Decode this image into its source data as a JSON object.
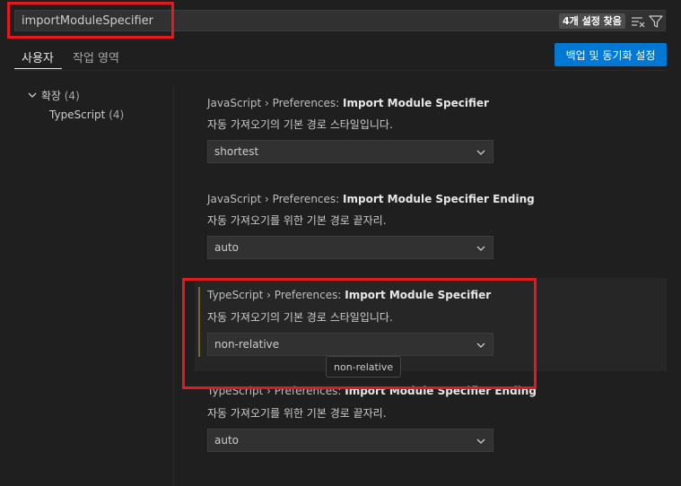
{
  "search": {
    "value": "importModuleSpecifier",
    "result_count": "4개 설정 찾음"
  },
  "tabs": [
    {
      "label": "사용자"
    },
    {
      "label": "작업 영역"
    }
  ],
  "sync_button": {
    "label": "백업 및 동기화 설정"
  },
  "tree": {
    "group": {
      "label": "확장",
      "count": "(4)"
    },
    "child": {
      "label": "TypeScript",
      "count": "(4)"
    }
  },
  "settings": [
    {
      "category": "JavaScript › Preferences: ",
      "name": "Import Module Specifier",
      "description": "자동 가져오기의 기본 경로 스타일입니다.",
      "value": "shortest"
    },
    {
      "category": "JavaScript › Preferences: ",
      "name": "Import Module Specifier Ending",
      "description": "자동 가져오기를 위한 기본 경로 끝자리.",
      "value": "auto"
    },
    {
      "category": "TypeScript › Preferences: ",
      "name": "Import Module Specifier",
      "description": "자동 가져오기의 기본 경로 스타일입니다.",
      "value": "non-relative"
    },
    {
      "category": "TypeScript › Preferences: ",
      "name": "Import Module Specifier Ending",
      "description": "자동 가져오기를 위한 기본 경로 끝자리.",
      "value": "auto"
    }
  ],
  "tooltip": {
    "text": "non-relative"
  },
  "colors": {
    "accent_button": "#0078d4",
    "highlight_box": "#e3191e",
    "background": "#1f1f1f"
  }
}
